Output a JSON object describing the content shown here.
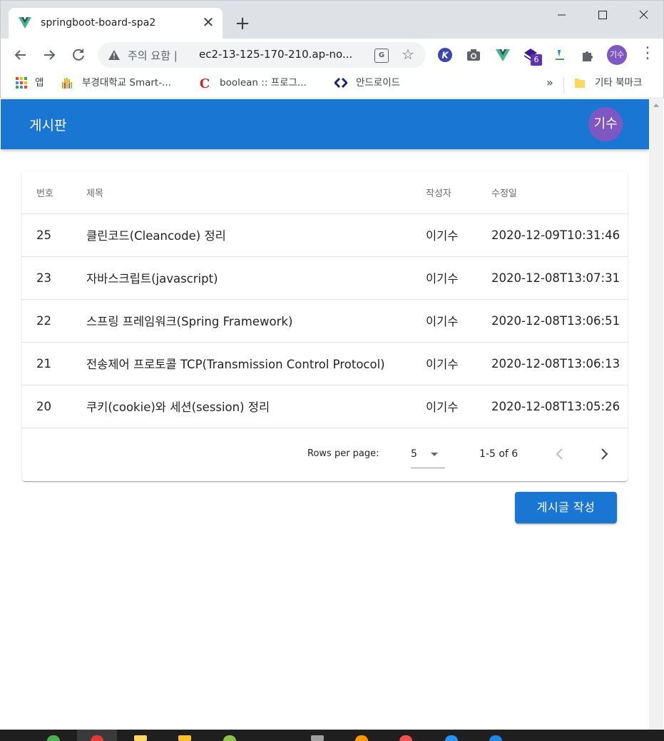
{
  "browser": {
    "tab_title": "springboot-board-spa2",
    "tab_close": "✕",
    "new_tab": "+",
    "security_label": "주의 요함 |",
    "url": "ec2-13-125-170-210.ap-no...",
    "translate_icon": "G",
    "ext_badge": "6",
    "profile_initials": "기수",
    "bookmarks": {
      "apps_label": "앱",
      "items": [
        "부경대학교 Smart-...",
        "boolean :: 프로그...",
        "안드로이드"
      ],
      "overflow": "»",
      "other_label": "기타 북마크"
    }
  },
  "app": {
    "title": "게시판",
    "avatar_initials": "기수",
    "table": {
      "headers": [
        "번호",
        "제목",
        "작성자",
        "수정일"
      ],
      "rows": [
        {
          "num": "25",
          "title": "클린코드(Cleancode) 정리",
          "author": "이기수",
          "date": "2020-12-09T10:31:46"
        },
        {
          "num": "23",
          "title": "자바스크립트(javascript)",
          "author": "이기수",
          "date": "2020-12-08T13:07:31"
        },
        {
          "num": "22",
          "title": "스프링 프레임워크(Spring Framework)",
          "author": "이기수",
          "date": "2020-12-08T13:06:51"
        },
        {
          "num": "21",
          "title": "전송제어 프로토콜 TCP(Transmission Control Protocol)",
          "author": "이기수",
          "date": "2020-12-08T13:06:13"
        },
        {
          "num": "20",
          "title": "쿠키(cookie)와 세션(session) 정리",
          "author": "이기수",
          "date": "2020-12-08T13:05:26"
        }
      ]
    },
    "pagination": {
      "rows_per_page_label": "Rows per page:",
      "rows_per_page_value": "5",
      "range_text": "1-5 of 6"
    },
    "write_button": "게시글 작성"
  },
  "colors": {
    "primary": "#1976d2",
    "avatar": "#7e57c2"
  }
}
